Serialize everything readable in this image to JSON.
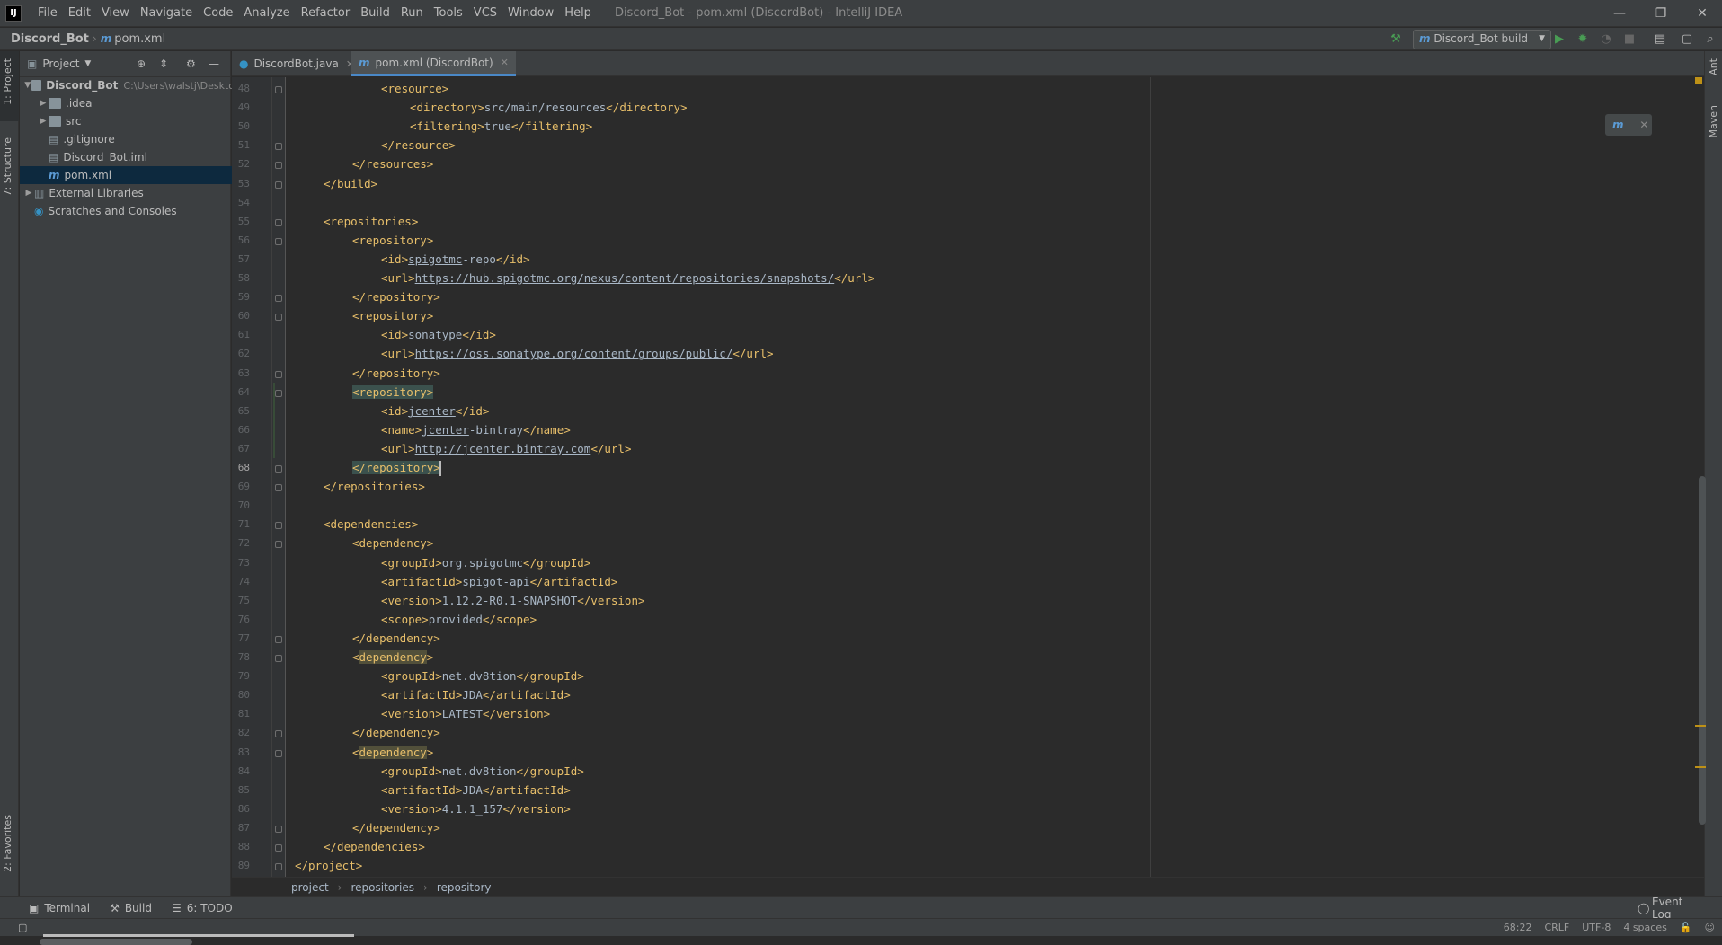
{
  "window": {
    "title": "Discord_Bot - pom.xml (DiscordBot) - IntelliJ IDEA",
    "menu": [
      "File",
      "Edit",
      "View",
      "Navigate",
      "Code",
      "Analyze",
      "Refactor",
      "Build",
      "Run",
      "Tools",
      "VCS",
      "Window",
      "Help"
    ],
    "controls": [
      "—",
      "❐",
      "✕"
    ]
  },
  "navbar": {
    "crumbs": [
      "Discord_Bot",
      "pom.xml"
    ],
    "run_config": "Discord_Bot build"
  },
  "left_strip": {
    "project": "1: Project",
    "structure": "7: Structure",
    "favorites": "2: Favorites"
  },
  "right_strip": {
    "ant": "Ant",
    "maven": "Maven"
  },
  "project_panel": {
    "title": "Project",
    "tree": [
      {
        "label": "Discord_Bot",
        "extra": "C:\\Users\\walstj\\Deskto",
        "indent": 0,
        "arrow": "▼",
        "icon": "folder",
        "bold": true
      },
      {
        "label": ".idea",
        "indent": 1,
        "arrow": "▶",
        "icon": "folder"
      },
      {
        "label": "src",
        "indent": 1,
        "arrow": "▶",
        "icon": "folder"
      },
      {
        "label": ".gitignore",
        "indent": 1,
        "arrow": "",
        "icon": "file"
      },
      {
        "label": "Discord_Bot.iml",
        "indent": 1,
        "arrow": "",
        "icon": "file"
      },
      {
        "label": "pom.xml",
        "indent": 1,
        "arrow": "",
        "icon": "maven",
        "selected": true
      },
      {
        "label": "External Libraries",
        "indent": 0,
        "arrow": "▶",
        "icon": "lib"
      },
      {
        "label": "Scratches and Consoles",
        "indent": 0,
        "arrow": "",
        "icon": "scratch"
      }
    ]
  },
  "tabs": [
    {
      "label": "DiscordBot.java",
      "active": false
    },
    {
      "label": "pom.xml (DiscordBot)",
      "active": true
    }
  ],
  "editor": {
    "current_line": 68,
    "lines": [
      {
        "n": 48,
        "indent": 3,
        "parts": [
          [
            "tag",
            "<resource>"
          ]
        ]
      },
      {
        "n": 49,
        "indent": 4,
        "parts": [
          [
            "tag",
            "<directory>"
          ],
          [
            "t",
            "src/main/resources"
          ],
          [
            "tag",
            "</directory>"
          ]
        ]
      },
      {
        "n": 50,
        "indent": 4,
        "parts": [
          [
            "tag",
            "<filtering>"
          ],
          [
            "t",
            "true"
          ],
          [
            "tag",
            "</filtering>"
          ]
        ]
      },
      {
        "n": 51,
        "indent": 3,
        "parts": [
          [
            "tag",
            "</resource>"
          ]
        ]
      },
      {
        "n": 52,
        "indent": 2,
        "parts": [
          [
            "tag",
            "</resources>"
          ]
        ]
      },
      {
        "n": 53,
        "indent": 1,
        "parts": [
          [
            "tag",
            "</build>"
          ]
        ]
      },
      {
        "n": 54,
        "indent": 0,
        "parts": []
      },
      {
        "n": 55,
        "indent": 1,
        "parts": [
          [
            "tag",
            "<repositories>"
          ]
        ]
      },
      {
        "n": 56,
        "indent": 2,
        "parts": [
          [
            "tag",
            "<repository>"
          ]
        ]
      },
      {
        "n": 57,
        "indent": 3,
        "parts": [
          [
            "tag",
            "<id>"
          ],
          [
            "u",
            "spigotmc"
          ],
          [
            "t",
            "-repo"
          ],
          [
            "tag",
            "</id>"
          ]
        ]
      },
      {
        "n": 58,
        "indent": 3,
        "parts": [
          [
            "tag",
            "<url>"
          ],
          [
            "u",
            "https://hub.spigotmc.org/nexus/content/repositories/snapshots/"
          ],
          [
            "tag",
            "</url>"
          ]
        ]
      },
      {
        "n": 59,
        "indent": 2,
        "parts": [
          [
            "tag",
            "</repository>"
          ]
        ]
      },
      {
        "n": 60,
        "indent": 2,
        "parts": [
          [
            "tag",
            "<repository>"
          ]
        ]
      },
      {
        "n": 61,
        "indent": 3,
        "parts": [
          [
            "tag",
            "<id>"
          ],
          [
            "u",
            "sonatype"
          ],
          [
            "tag",
            "</id>"
          ]
        ]
      },
      {
        "n": 62,
        "indent": 3,
        "parts": [
          [
            "tag",
            "<url>"
          ],
          [
            "u",
            "https://oss.sonatype.org/content/groups/public/"
          ],
          [
            "tag",
            "</url>"
          ]
        ]
      },
      {
        "n": 63,
        "indent": 2,
        "parts": [
          [
            "tag",
            "</repository>"
          ]
        ]
      },
      {
        "n": 64,
        "indent": 2,
        "parts": [
          [
            "hl",
            "<repository>"
          ]
        ]
      },
      {
        "n": 65,
        "indent": 3,
        "parts": [
          [
            "tag",
            "<id>"
          ],
          [
            "u",
            "jcenter"
          ],
          [
            "tag",
            "</id>"
          ]
        ]
      },
      {
        "n": 66,
        "indent": 3,
        "parts": [
          [
            "tag",
            "<name>"
          ],
          [
            "u",
            "jcenter"
          ],
          [
            "t",
            "-bintray"
          ],
          [
            "tag",
            "</name>"
          ]
        ]
      },
      {
        "n": 67,
        "indent": 3,
        "parts": [
          [
            "tag",
            "<url>"
          ],
          [
            "u",
            "http://jcenter.bintray.com"
          ],
          [
            "tag",
            "</url>"
          ]
        ]
      },
      {
        "n": 68,
        "indent": 2,
        "parts": [
          [
            "hl",
            "</repository>"
          ]
        ]
      },
      {
        "n": 69,
        "indent": 1,
        "parts": [
          [
            "tag",
            "</repositories>"
          ]
        ]
      },
      {
        "n": 70,
        "indent": 0,
        "parts": []
      },
      {
        "n": 71,
        "indent": 1,
        "parts": [
          [
            "tag",
            "<dependencies>"
          ]
        ]
      },
      {
        "n": 72,
        "indent": 2,
        "parts": [
          [
            "tag",
            "<dependency>"
          ]
        ]
      },
      {
        "n": 73,
        "indent": 3,
        "parts": [
          [
            "tag",
            "<groupId>"
          ],
          [
            "t",
            "org.spigotmc"
          ],
          [
            "tag",
            "</groupId>"
          ]
        ]
      },
      {
        "n": 74,
        "indent": 3,
        "parts": [
          [
            "tag",
            "<artifactId>"
          ],
          [
            "t",
            "spigot-api"
          ],
          [
            "tag",
            "</artifactId>"
          ]
        ]
      },
      {
        "n": 75,
        "indent": 3,
        "parts": [
          [
            "tag",
            "<version>"
          ],
          [
            "t",
            "1.12.2-R0.1-SNAPSHOT"
          ],
          [
            "tag",
            "</version>"
          ]
        ]
      },
      {
        "n": 76,
        "indent": 3,
        "parts": [
          [
            "tag",
            "<scope>"
          ],
          [
            "t",
            "provided"
          ],
          [
            "tag",
            "</scope>"
          ]
        ]
      },
      {
        "n": 77,
        "indent": 2,
        "parts": [
          [
            "tag",
            "</dependency>"
          ]
        ]
      },
      {
        "n": 78,
        "indent": 2,
        "parts": [
          [
            "tag",
            "<"
          ],
          [
            "hy",
            "dependency"
          ],
          [
            "tag",
            ">"
          ]
        ]
      },
      {
        "n": 79,
        "indent": 3,
        "parts": [
          [
            "tag",
            "<groupId>"
          ],
          [
            "t",
            "net.dv8tion"
          ],
          [
            "tag",
            "</groupId>"
          ]
        ]
      },
      {
        "n": 80,
        "indent": 3,
        "parts": [
          [
            "tag",
            "<artifactId>"
          ],
          [
            "t",
            "JDA"
          ],
          [
            "tag",
            "</artifactId>"
          ]
        ]
      },
      {
        "n": 81,
        "indent": 3,
        "parts": [
          [
            "tag",
            "<version>"
          ],
          [
            "t",
            "LATEST"
          ],
          [
            "tag",
            "</version>"
          ]
        ]
      },
      {
        "n": 82,
        "indent": 2,
        "parts": [
          [
            "tag",
            "</dependency>"
          ]
        ]
      },
      {
        "n": 83,
        "indent": 2,
        "parts": [
          [
            "tag",
            "<"
          ],
          [
            "hy",
            "dependency"
          ],
          [
            "tag",
            ">"
          ]
        ]
      },
      {
        "n": 84,
        "indent": 3,
        "parts": [
          [
            "tag",
            "<groupId>"
          ],
          [
            "t",
            "net.dv8tion"
          ],
          [
            "tag",
            "</groupId>"
          ]
        ]
      },
      {
        "n": 85,
        "indent": 3,
        "parts": [
          [
            "tag",
            "<artifactId>"
          ],
          [
            "t",
            "JDA"
          ],
          [
            "tag",
            "</artifactId>"
          ]
        ]
      },
      {
        "n": 86,
        "indent": 3,
        "parts": [
          [
            "tag",
            "<version>"
          ],
          [
            "t",
            "4.1.1_157"
          ],
          [
            "tag",
            "</version>"
          ]
        ]
      },
      {
        "n": 87,
        "indent": 2,
        "parts": [
          [
            "tag",
            "</dependency>"
          ]
        ]
      },
      {
        "n": 88,
        "indent": 1,
        "parts": [
          [
            "tag",
            "</dependencies>"
          ]
        ]
      },
      {
        "n": 89,
        "indent": 0,
        "parts": [
          [
            "tag",
            "</project>"
          ]
        ]
      }
    ]
  },
  "breadcrumbs": [
    "project",
    "repositories",
    "repository"
  ],
  "tool_windows": [
    "Terminal",
    "Build",
    "6: TODO"
  ],
  "event_log": "Event Log",
  "status": {
    "position": "68:22",
    "line_sep": "CRLF",
    "encoding": "UTF-8",
    "indent": "4 spaces"
  },
  "colors": {
    "tag": "#e8bf6a",
    "text": "#a9b7c6",
    "tag_match_bg": "#3b514d",
    "identifier_bg": "#52503a"
  }
}
